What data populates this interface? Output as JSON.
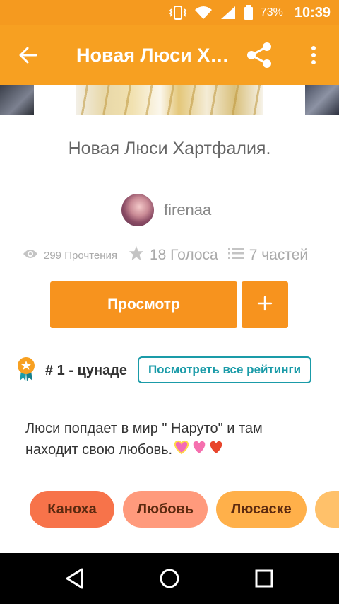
{
  "status_bar": {
    "battery_percent": "73%",
    "time": "10:39",
    "icons": [
      "vibrate-icon",
      "wifi-icon",
      "signal-icon",
      "battery-icon"
    ]
  },
  "app_bar": {
    "title": "Новая Люси Хартфалия.",
    "icons": [
      "back-arrow-icon",
      "share-icon",
      "more-vert-icon"
    ],
    "color": "#f7a021"
  },
  "story": {
    "title": "Новая Люси Хартфалия.",
    "author": "firenaa",
    "stats": {
      "reads": "299 Прочтения",
      "votes": "18 Голоса",
      "parts": "7 частей"
    }
  },
  "actions": {
    "read_label": "Просмотр",
    "add_icon": "plus-icon",
    "accent": "#f7931e"
  },
  "ranking": {
    "text": "# 1 - цунаде",
    "see_all_label": "Посмотреть все рейтинги",
    "button_color": "#1a9ba8"
  },
  "description": {
    "text": "Люси попдает в мир \" Наруто\" и там находит свою любовь.",
    "emojis": [
      "sparkling-heart-icon",
      "pink-heart-icon",
      "red-heart-icon"
    ]
  },
  "tags": [
    {
      "label": "Каноха",
      "color": "#f7734a"
    },
    {
      "label": "Любовь",
      "color": "#ff9a7c"
    },
    {
      "label": "Люсаске",
      "color": "#ffb04a"
    },
    {
      "label": "",
      "color": "#ffc16a"
    }
  ],
  "nav_bar": {
    "icons": [
      "back-triangle-icon",
      "home-circle-icon",
      "recents-square-icon"
    ]
  }
}
